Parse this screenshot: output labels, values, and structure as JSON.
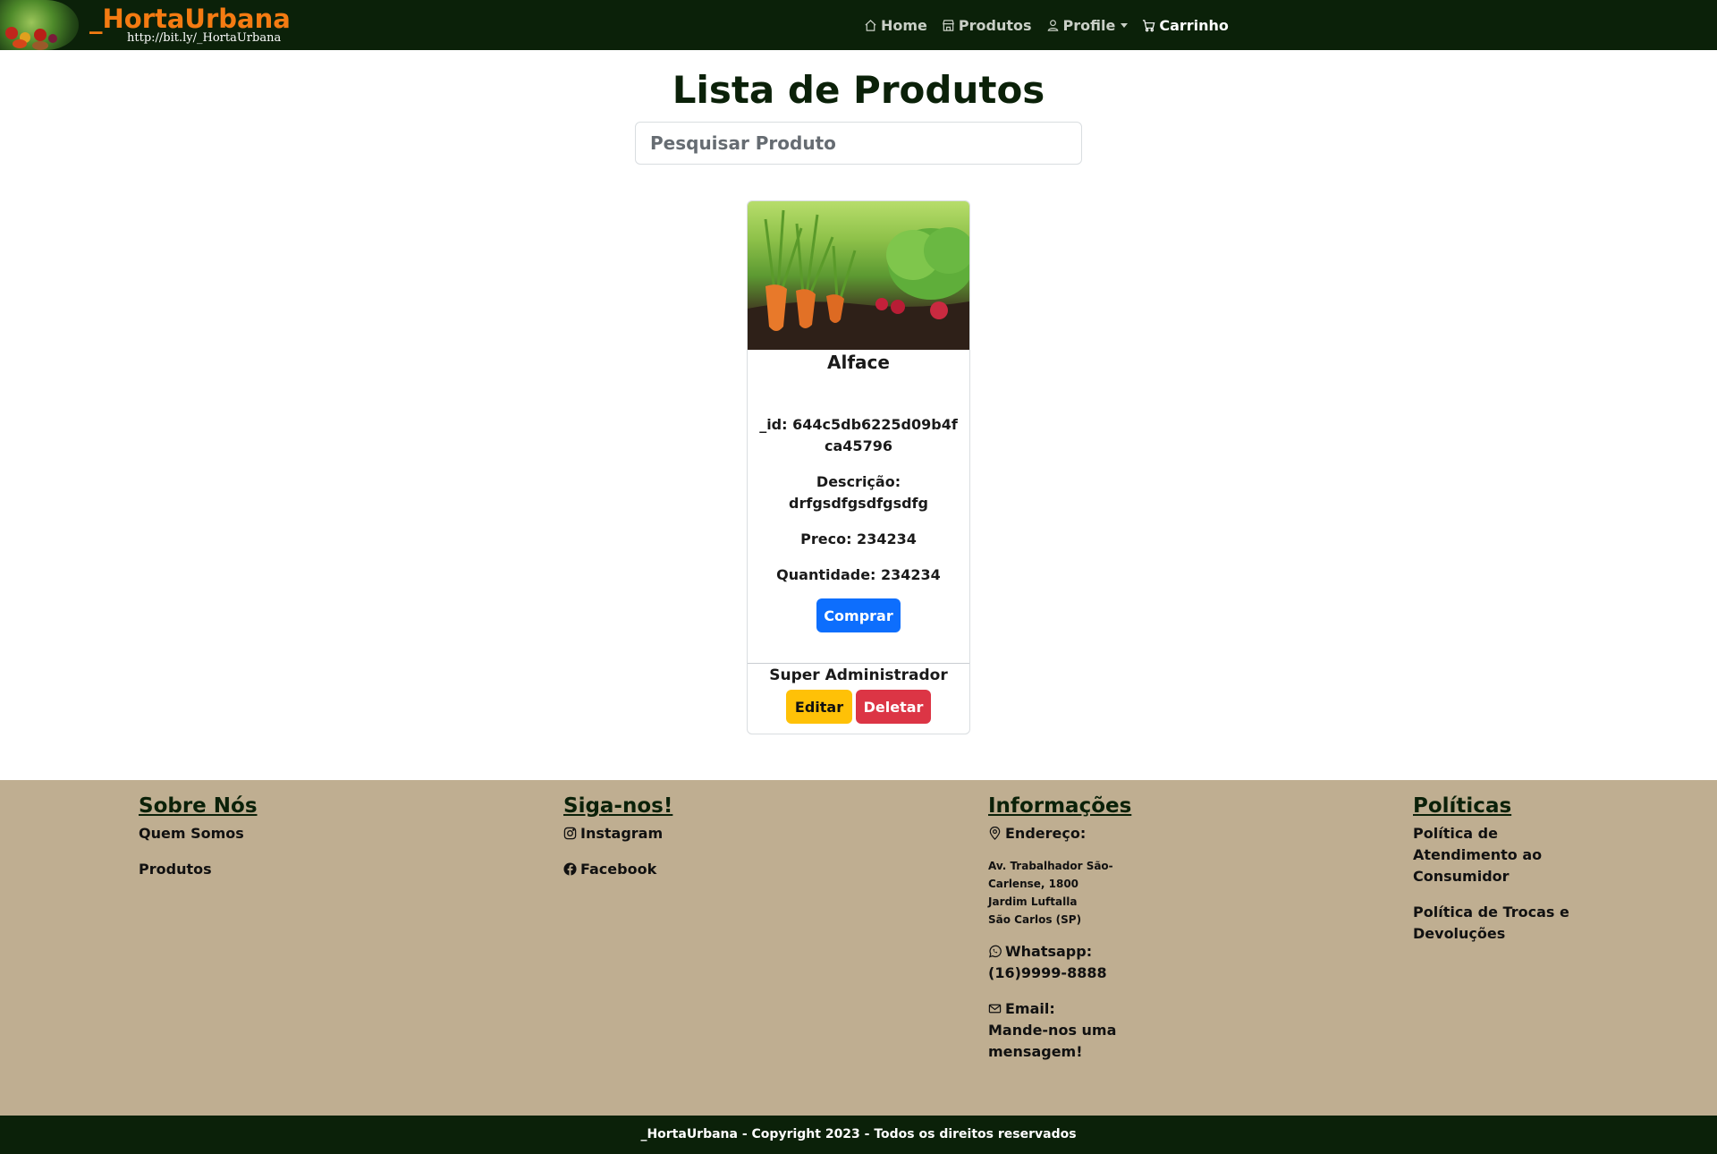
{
  "navbar": {
    "brand_title": "_HortaUrbana",
    "brand_subtitle": "http://bit.ly/_HortaUrbana",
    "items": [
      {
        "label": "Home",
        "icon": "house-icon"
      },
      {
        "label": "Produtos",
        "icon": "shop-icon"
      },
      {
        "label": "Profile",
        "icon": "person-icon"
      },
      {
        "label": "Carrinho",
        "icon": "cart-icon"
      }
    ]
  },
  "main": {
    "title": "Lista de Produtos",
    "search_placeholder": "Pesquisar Produto"
  },
  "product": {
    "name": "Alface",
    "id_line": "_id: 644c5db6225d09b4fca45796",
    "description_label": "Descrição:",
    "description_value": "drfgsdfgsdfgsdfg",
    "price_line": "Preco: 234234",
    "quantity_line": "Quantidade: 234234",
    "buy_label": "Comprar",
    "admin_label": "Super Administrador",
    "edit_label": "Editar",
    "delete_label": "Deletar"
  },
  "footer": {
    "about": {
      "title": "Sobre Nós",
      "links": [
        "Quem Somos",
        "Produtos"
      ]
    },
    "follow": {
      "title": "Siga-nos!",
      "links": [
        "Instagram",
        "Facebook"
      ]
    },
    "info": {
      "title": "Informações",
      "address_label": "Endereço:",
      "address_lines": [
        "Av. Trabalhador São-",
        "Carlense, 1800",
        "Jardim Luftalla",
        "São Carlos (SP)"
      ],
      "whatsapp_label": "Whatsapp:",
      "whatsapp_value": "(16)9999-8888",
      "email_label": "Email:",
      "email_value": "Mande-nos uma mensagem!"
    },
    "policies": {
      "title": "Políticas",
      "links": [
        "Política de Atendimento ao Consumidor",
        "Política de Trocas e Devoluções"
      ]
    },
    "copyright": "_HortaUrbana - Copyright 2023 - Todos os direitos reservados"
  },
  "colors": {
    "navbar_bg": "#0b2109",
    "brand_orange": "#f47b12",
    "footer_bg": "#bfae91",
    "buy_blue": "#0d6efd",
    "edit_yellow": "#ffc107",
    "delete_red": "#dc3545"
  }
}
